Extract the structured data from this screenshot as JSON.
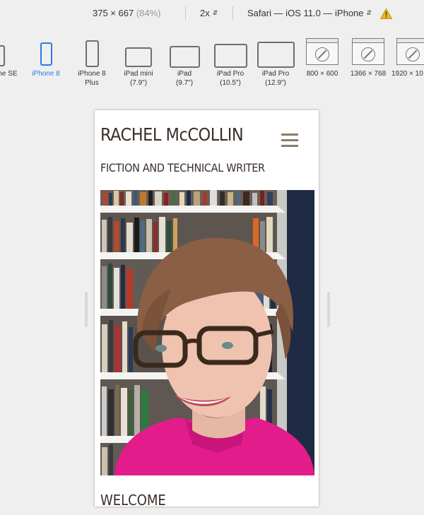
{
  "toolbar": {
    "dimensions": "375 × 667",
    "zoom": "(84%)",
    "scale": "2x",
    "user_agent": "Safari — iOS 11.0 — iPhone",
    "chevron": "⌃⌄"
  },
  "devices": [
    {
      "label": "ne SE",
      "label2": ""
    },
    {
      "label": "iPhone 8",
      "label2": ""
    },
    {
      "label": "iPhone 8",
      "label2": "Plus"
    },
    {
      "label": "iPad mini",
      "label2": "(7.9\")"
    },
    {
      "label": "iPad",
      "label2": "(9.7\")"
    },
    {
      "label": "iPad Pro",
      "label2": "(10.5\")"
    },
    {
      "label": "iPad Pro",
      "label2": "(12.9\")"
    },
    {
      "label": "800 × 600",
      "label2": ""
    },
    {
      "label": "1366 × 768",
      "label2": ""
    },
    {
      "label": "1920 × 10",
      "label2": ""
    }
  ],
  "site": {
    "title": "RACHEL McCOLLIN",
    "tagline": "FICTION AND TECHNICAL WRITER",
    "welcome": "WELCOME"
  }
}
